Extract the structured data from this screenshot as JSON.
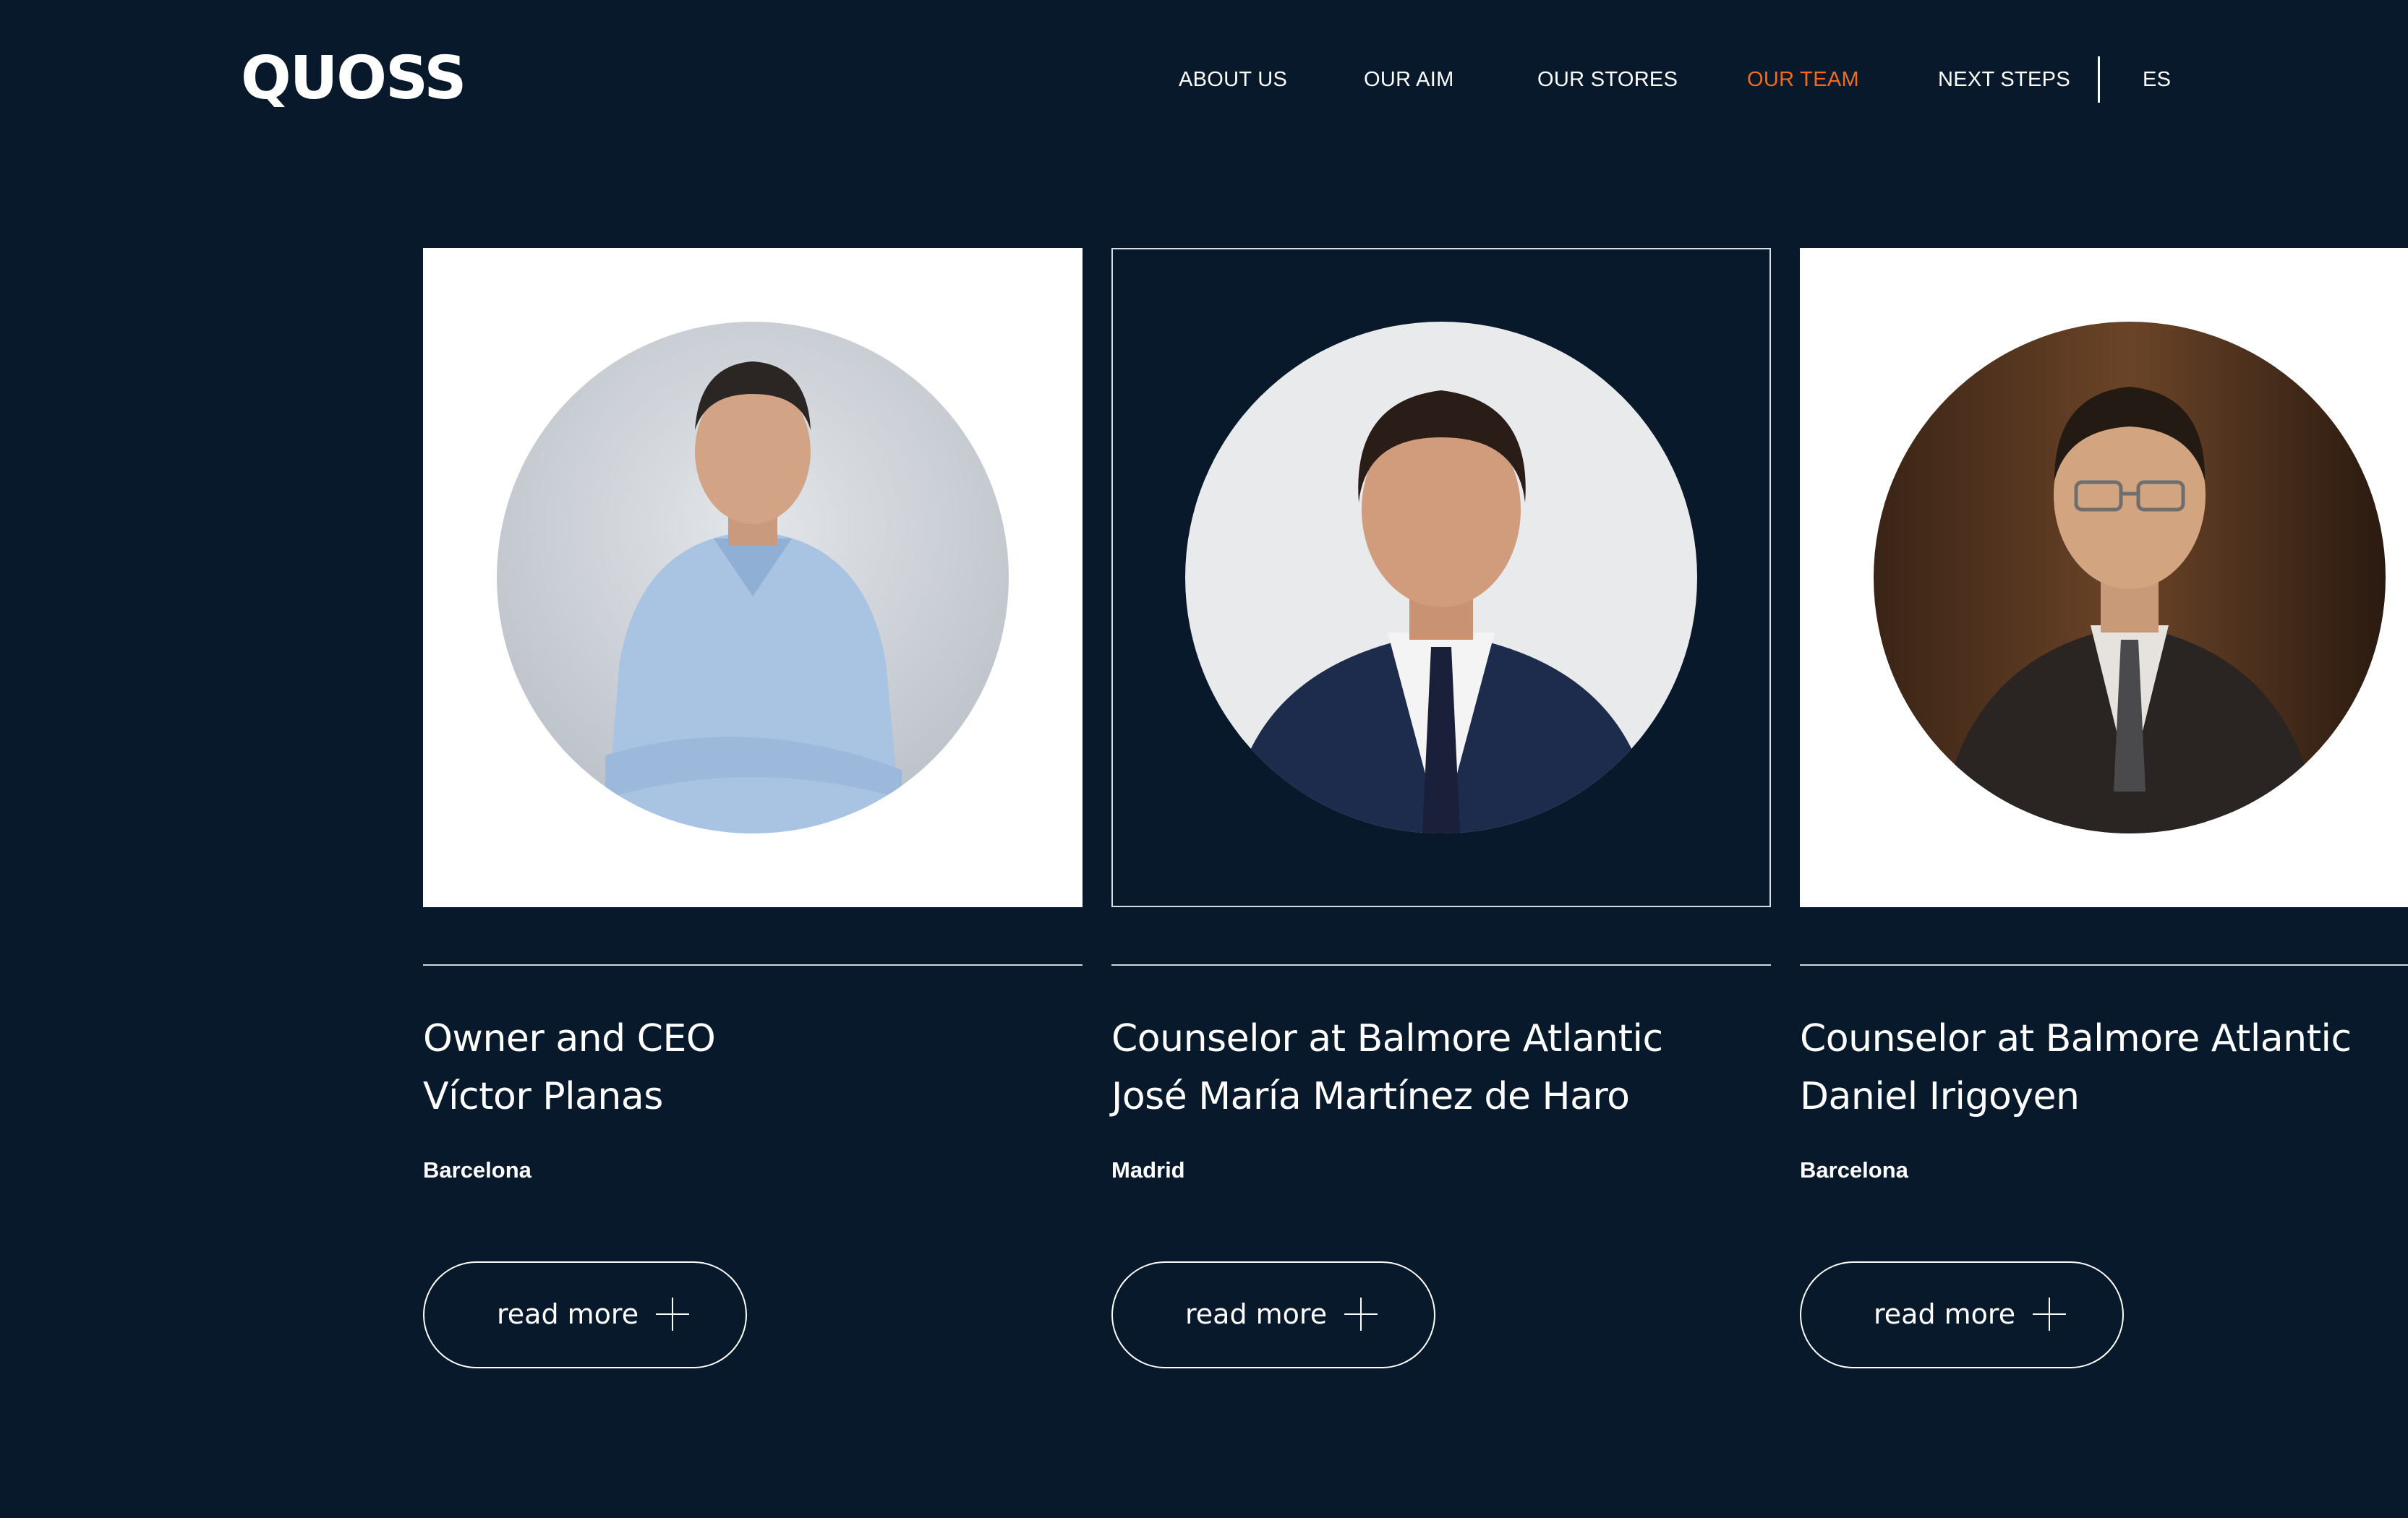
{
  "header": {
    "logo_text": "QUOSS",
    "nav": [
      {
        "label": "ABOUT US",
        "active": false
      },
      {
        "label": "OUR AIM",
        "active": false
      },
      {
        "label": "OUR STORES",
        "active": false
      },
      {
        "label": "OUR TEAM",
        "active": true
      },
      {
        "label": "NEXT STEPS",
        "active": false
      }
    ],
    "language": "ES"
  },
  "colors": {
    "background": "#07192a",
    "accent": "#f26b1d",
    "text": "#ffffff"
  },
  "team": [
    {
      "role": "Owner and CEO",
      "name": "Víctor Planas",
      "city": "Barcelona",
      "button": "read more",
      "button_icon": "plus-icon"
    },
    {
      "role": "Counselor at Balmore Atlantic",
      "name": "José María Martínez de Haro",
      "city": "Madrid",
      "button": "read more",
      "button_icon": "plus-icon"
    },
    {
      "role": "Counselor at Balmore Atlantic",
      "name": "Daniel Irigoyen",
      "city": "Barcelona",
      "button": "read more",
      "button_icon": "plus-icon"
    }
  ]
}
